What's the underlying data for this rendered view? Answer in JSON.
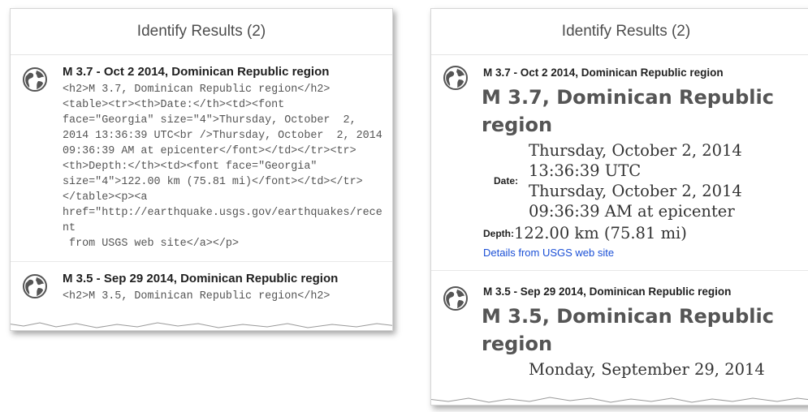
{
  "left": {
    "header": "Identify Results (2)",
    "results": [
      {
        "title": "M 3.7 - Oct 2 2014, Dominican Republic region",
        "raw": "<h2>M 3.7, Dominican Republic region</h2>\n<table><tr><th>Date:</th><td><font\nface=\"Georgia\" size=\"4\">Thursday, October  2,\n2014 13:36:39 UTC<br />Thursday, October  2, 2014\n09:36:39 AM at epicenter</font></td></tr><tr>\n<th>Depth:</th><td><font face=\"Georgia\"\nsize=\"4\">122.00 km (75.81 mi)</font></td></tr>\n</table><p><a\nhref=\"http://earthquake.usgs.gov/earthquakes/recent\n from USGS web site</a></p>"
      },
      {
        "title": "M 3.5 - Sep 29 2014, Dominican Republic region",
        "raw": "<h2>M 3.5, Dominican Republic region</h2>"
      }
    ]
  },
  "right": {
    "header": "Identify Results (2)",
    "results": [
      {
        "title": "M 3.7 - Oct 2 2014, Dominican Republic region",
        "heading_line1": "M 3.7, Dominican Republic",
        "heading_line2": "region",
        "date_label": "Date:",
        "date_line1": "Thursday, October  2, 2014",
        "date_line2": "13:36:39 UTC",
        "date_line3": "Thursday, October  2, 2014",
        "date_line4": "09:36:39 AM at epicenter",
        "depth_label": "Depth:",
        "depth_value": "122.00 km (75.81 mi)",
        "link_text": "Details from USGS web site"
      },
      {
        "title": "M 3.5 - Sep 29 2014, Dominican Republic region",
        "heading_line1": "M 3.5, Dominican Republic",
        "heading_line2": "region",
        "date_line1": "Monday, September 29, 2014"
      }
    ]
  },
  "colors": {
    "link": "#1a4fd6",
    "text": "#555555",
    "header": "#4d4d4d"
  },
  "icons": {
    "result": "globe-icon"
  }
}
